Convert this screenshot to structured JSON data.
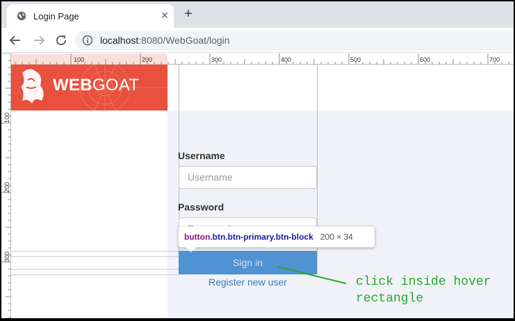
{
  "browser": {
    "tab_title": "Login Page",
    "tab_close": "✕",
    "new_tab": "+",
    "url_host": "localhost",
    "url_rest": ":8080/WebGoat/login"
  },
  "ruler": {
    "top_ticks": [
      "100",
      "200",
      "300",
      "400",
      "500",
      "600",
      "700"
    ],
    "left_ticks": [
      "100",
      "200",
      "300"
    ]
  },
  "logo": {
    "bold": "WEB",
    "rest": "GOAT"
  },
  "form": {
    "username_label": "Username",
    "username_placeholder": "Username",
    "password_label": "Password",
    "password_placeholder": "Password",
    "signin_label": "Sign in",
    "register_label": "Register new user"
  },
  "inspector": {
    "tag": "button",
    "classes": ".btn.btn-primary.btn-block",
    "dimensions": "200 × 34"
  },
  "annotation": {
    "line1": "click inside hover",
    "line2": "rectangle",
    "color": "#29a830"
  },
  "icons": [
    "globe-icon",
    "close-icon",
    "plus-icon",
    "back-arrow-icon",
    "forward-arrow-icon",
    "reload-icon",
    "info-icon",
    "goat-logo-icon"
  ]
}
